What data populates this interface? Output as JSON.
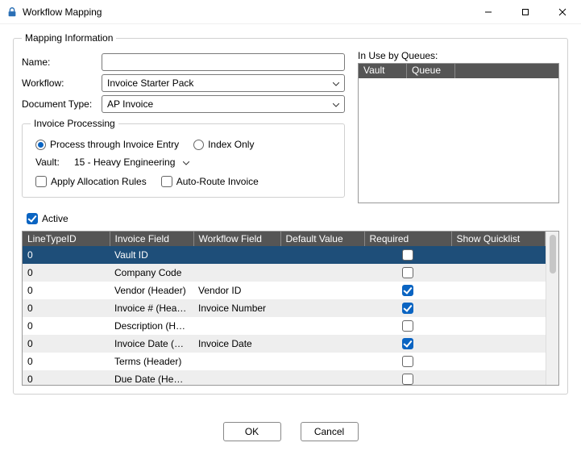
{
  "window": {
    "title": "Workflow Mapping"
  },
  "group": {
    "mapping_info": "Mapping Information",
    "invoice_proc": "Invoice Processing"
  },
  "labels": {
    "name": "Name:",
    "workflow": "Workflow:",
    "document_type": "Document Type:",
    "vault": "Vault:",
    "in_use": "In Use by Queues:",
    "active": "Active",
    "apply_alloc": "Apply Allocation Rules",
    "auto_route": "Auto-Route Invoice",
    "proc_entry": "Process through Invoice Entry",
    "index_only": "Index Only"
  },
  "values": {
    "name": "",
    "workflow": "Invoice Starter Pack",
    "document_type": "AP Invoice",
    "vault": "15 - Heavy Engineering",
    "proc_mode": "entry",
    "apply_alloc": false,
    "auto_route": false,
    "active": true
  },
  "in_use_cols": {
    "vault": "Vault",
    "queue": "Queue"
  },
  "grid_headers": {
    "linetype": "LineTypeID",
    "invoice_field": "Invoice Field",
    "workflow_field": "Workflow Field",
    "default_value": "Default Value",
    "required": "Required",
    "show_quicklist": "Show Quicklist"
  },
  "grid_rows": [
    {
      "linetype": "0",
      "invoice_field": "Vault ID",
      "workflow_field": "",
      "default_value": "",
      "required": false,
      "selected": true
    },
    {
      "linetype": "0",
      "invoice_field": "Company Code",
      "workflow_field": "",
      "default_value": "",
      "required": false
    },
    {
      "linetype": "0",
      "invoice_field": "Vendor   (Header)",
      "workflow_field": "Vendor ID",
      "default_value": "",
      "required": true
    },
    {
      "linetype": "0",
      "invoice_field": "Invoice #   (Header)",
      "workflow_field": "Invoice Number",
      "default_value": "",
      "required": true
    },
    {
      "linetype": "0",
      "invoice_field": "Description   (Hea...",
      "workflow_field": "",
      "default_value": "",
      "required": false
    },
    {
      "linetype": "0",
      "invoice_field": "Invoice Date   (He...",
      "workflow_field": "Invoice Date",
      "default_value": "",
      "required": true
    },
    {
      "linetype": "0",
      "invoice_field": "Terms   (Header)",
      "workflow_field": "",
      "default_value": "",
      "required": false
    },
    {
      "linetype": "0",
      "invoice_field": "Due Date   (Header)",
      "workflow_field": "",
      "default_value": "",
      "required": false
    }
  ],
  "buttons": {
    "ok": "OK",
    "cancel": "Cancel"
  }
}
